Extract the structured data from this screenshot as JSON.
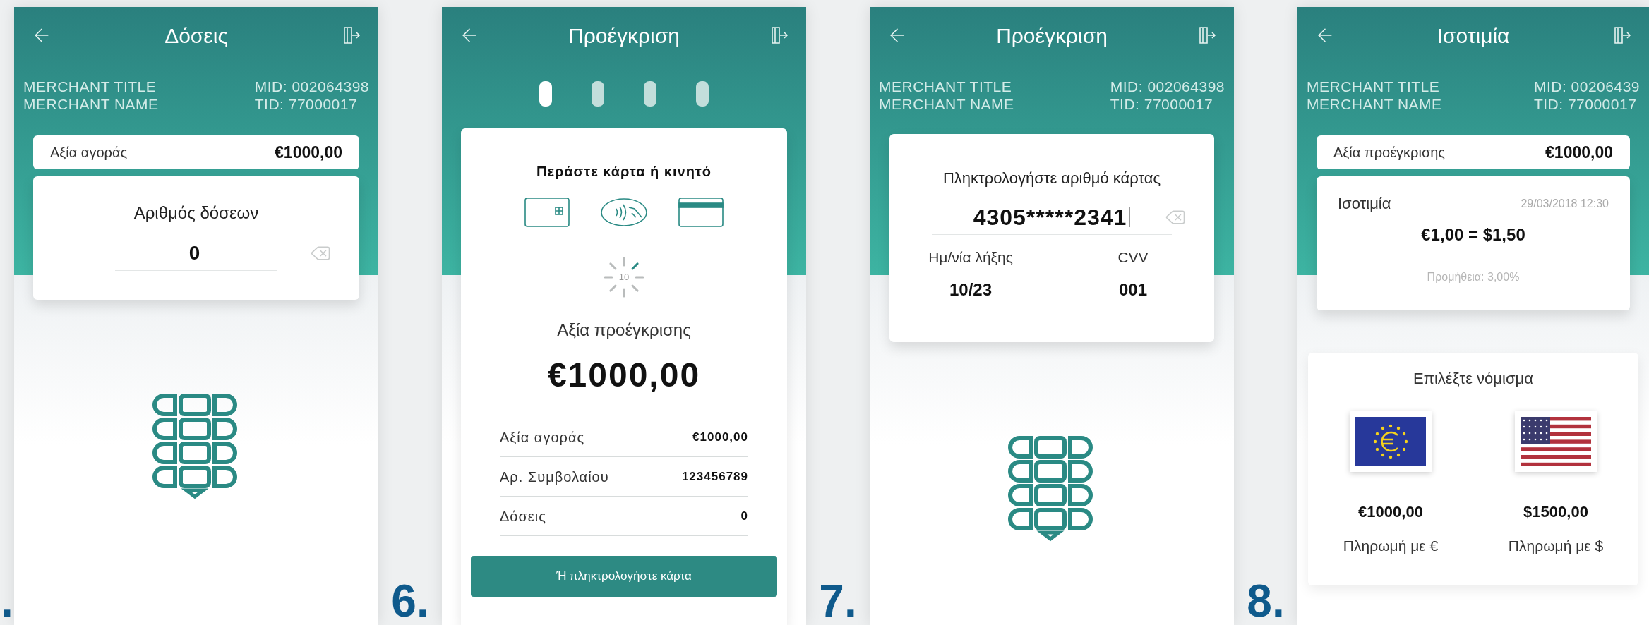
{
  "screens": [
    {
      "number_label": ".",
      "kind": "installments",
      "title": "Δόσεις",
      "merchant": {
        "title": "MERCHANT TITLE",
        "name": "MERCHANT NAME",
        "mid": "MID: 002064398",
        "tid": "TID: 77000017"
      },
      "amount_bar": {
        "label": "Αξία αγοράς",
        "value": "€1000,00"
      },
      "prompt": "Αριθμός δόσεων",
      "input_value": "0"
    },
    {
      "number_label": "6.",
      "kind": "card_prompt",
      "title": "Προέγκριση",
      "steps": [
        {
          "selected": true
        },
        {
          "selected": false
        },
        {
          "selected": false
        },
        {
          "selected": false
        }
      ],
      "prompt": "Περάστε κάρτα ή κινητό",
      "countdown": "10",
      "amount_label": "Αξία προέγκρισης",
      "amount": "€1000,00",
      "rows": [
        {
          "label": "Αξία αγοράς",
          "value": "€1000,00"
        },
        {
          "label": "Αρ. Συμβολαίου",
          "value": "123456789"
        },
        {
          "label": "Δόσεις",
          "value": "0"
        }
      ],
      "button": "Ή πληκτρολογήστε κάρτα"
    },
    {
      "number_label": "7.",
      "kind": "card_entry",
      "title": "Προέγκριση",
      "merchant": {
        "title": "MERCHANT TITLE",
        "name": "MERCHANT NAME",
        "mid": "MID: 002064398",
        "tid": "TID: 77000017"
      },
      "prompt": "Πληκτρολογήστε αριθμό κάρτας",
      "input_value": "4305*****2341",
      "fields": [
        {
          "label": "Ημ/νία λήξης",
          "value": "10/23"
        },
        {
          "label": "CVV",
          "value": "001"
        }
      ]
    },
    {
      "number_label": "8.",
      "kind": "currency",
      "title": "Ισοτιμία",
      "merchant": {
        "title": "MERCHANT TITLE",
        "name": "MERCHANT NAME",
        "mid": "MID: 00206439",
        "tid": "TID: 77000017"
      },
      "amount_bar": {
        "label": "Αξία προέγκρισης",
        "value": "€1000,00"
      },
      "rate": {
        "label": "Ισοτιμία",
        "date": "29/03/2018 12:30",
        "value": "€1,00 = $1,50",
        "fee": "Προμήθεια: 3,00%"
      },
      "choose_label": "Επιλέξτε νόμισμα",
      "options": [
        {
          "kind": "eur",
          "amount": "€1000,00",
          "label": "Πληρωμή με €"
        },
        {
          "kind": "usd",
          "amount": "$1500,00",
          "label": "Πληρωμή με $"
        }
      ]
    }
  ]
}
